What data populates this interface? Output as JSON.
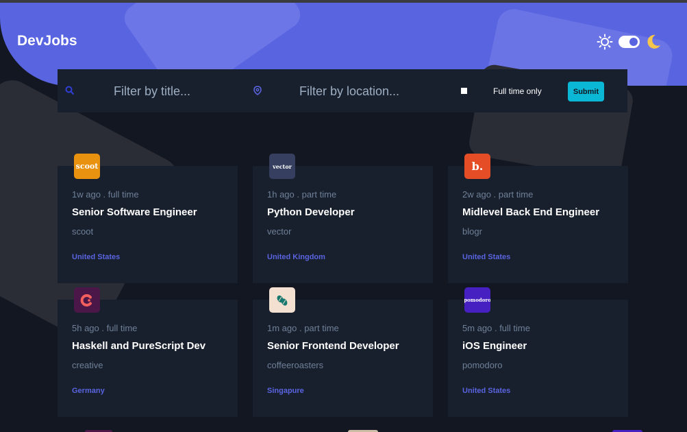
{
  "app": {
    "title": "DevJobs"
  },
  "filters": {
    "title_placeholder": "Filter by title...",
    "location_placeholder": "Filter by location...",
    "fulltime_label": "Full time only",
    "submit_label": "Submit"
  },
  "jobs": [
    {
      "logo_text": "scoot",
      "logo_color": "#e99210",
      "posted": "1w ago",
      "contract": "full time",
      "meta": "1w ago . full time",
      "title": "Senior Software Engineer",
      "company": "scoot",
      "location": "United States"
    },
    {
      "logo_text": "vector",
      "logo_color": "#363f5f",
      "posted": "1h ago",
      "contract": "part time",
      "meta": "1h ago . part time",
      "title": "Python Developer",
      "company": "vector",
      "location": "United Kingdom"
    },
    {
      "logo_text": "b.",
      "logo_color": "#e54d26",
      "posted": "2w ago",
      "contract": "part time",
      "meta": "2w ago . part time",
      "title": "Midlevel Back End Engineer",
      "company": "blogr",
      "location": "United States"
    },
    {
      "logo_text": "",
      "logo_color": "#4b1749",
      "posted": "5h ago",
      "contract": "full time",
      "meta": "5h ago . full time",
      "title": "Haskell and PureScript Dev",
      "company": "creative",
      "location": "Germany"
    },
    {
      "logo_text": "",
      "logo_color": "#f4e0d0",
      "posted": "1m ago",
      "contract": "part time",
      "meta": "1m ago . part time",
      "title": "Senior Frontend Developer",
      "company": "coffeeroasters",
      "location": "Singapure"
    },
    {
      "logo_text": "pomodoro",
      "logo_color": "#4720c1",
      "posted": "5m ago",
      "contract": "full time",
      "meta": "5m ago . full time",
      "title": "iOS Engineer",
      "company": "pomodoro",
      "location": "United States"
    }
  ],
  "colors": {
    "accent": "#5964e0",
    "background": "#121721",
    "card": "#19202d",
    "submit": "#0ab8d6",
    "muted": "#6e8098"
  },
  "icons": [
    "search-icon",
    "location-icon",
    "sun-icon",
    "moon-icon"
  ]
}
